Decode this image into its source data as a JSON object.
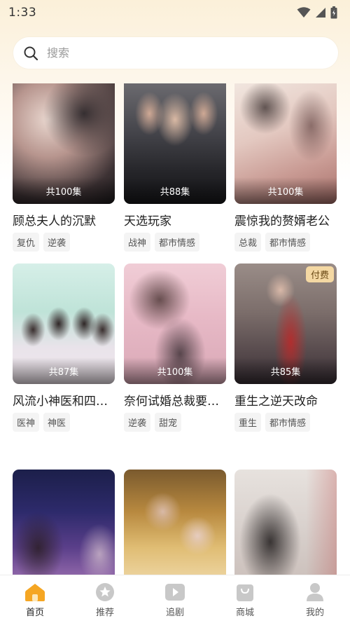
{
  "status": {
    "time": "1:33"
  },
  "search": {
    "placeholder": "搜索"
  },
  "dramas": [
    {
      "title": "顾总夫人的沉默",
      "episodes": "共100集",
      "tags": [
        "复仇",
        "逆袭"
      ],
      "paid": false,
      "badge": ""
    },
    {
      "title": "天选玩家",
      "episodes": "共88集",
      "tags": [
        "战神",
        "都市情感"
      ],
      "paid": false,
      "badge": ""
    },
    {
      "title": "震惊我的赘婿老公",
      "episodes": "共100集",
      "tags": [
        "总裁",
        "都市情感"
      ],
      "paid": false,
      "badge": ""
    },
    {
      "title": "风流小神医和四个绝色师姐",
      "episodes": "共87集",
      "tags": [
        "医神",
        "神医"
      ],
      "paid": false,
      "badge": ""
    },
    {
      "title": "奈何试婚总裁要娶我",
      "episodes": "共100集",
      "tags": [
        "逆袭",
        "甜宠"
      ],
      "paid": false,
      "badge": ""
    },
    {
      "title": "重生之逆天改命",
      "episodes": "共85集",
      "tags": [
        "重生",
        "都市情感"
      ],
      "paid": true,
      "badge": "付费"
    },
    {
      "title": "",
      "episodes": "",
      "tags": [],
      "paid": false,
      "badge": ""
    },
    {
      "title": "",
      "episodes": "",
      "tags": [],
      "paid": false,
      "badge": ""
    },
    {
      "title": "",
      "episodes": "",
      "tags": [],
      "paid": false,
      "badge": ""
    }
  ],
  "tabbar": [
    {
      "label": "首页",
      "icon": "home-icon",
      "active": true
    },
    {
      "label": "推荐",
      "icon": "star-icon",
      "active": false
    },
    {
      "label": "追剧",
      "icon": "play-icon",
      "active": false
    },
    {
      "label": "商城",
      "icon": "shop-bag-icon",
      "active": false
    },
    {
      "label": "我的",
      "icon": "person-icon",
      "active": false
    }
  ],
  "colors": {
    "accent": "#f5a623",
    "inactive_icon": "#c8c8c8"
  }
}
